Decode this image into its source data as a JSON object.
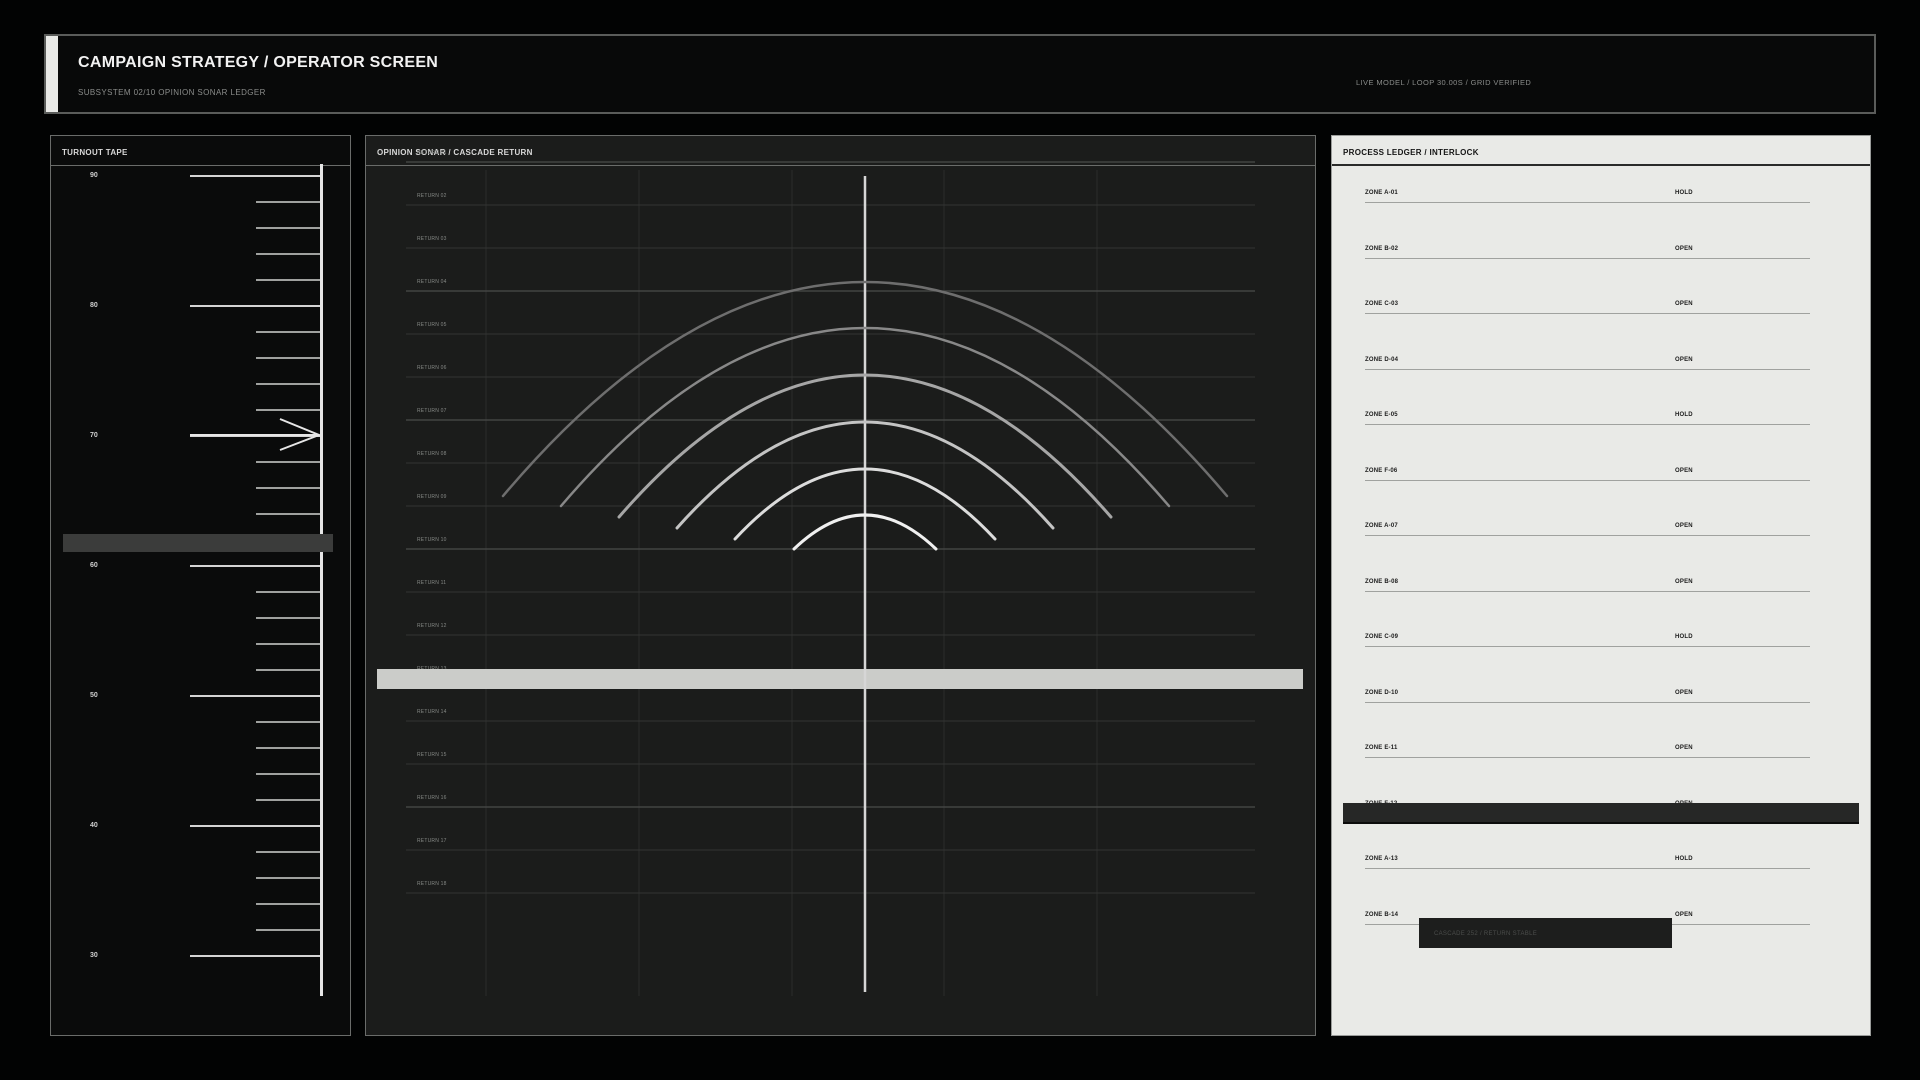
{
  "header": {
    "title": "CAMPAIGN STRATEGY / OPERATOR SCREEN",
    "subtitle": "SUBSYSTEM 02/10  OPINION SONAR LEDGER",
    "status": "LIVE MODEL / LOOP 30.00S / GRID VERIFIED"
  },
  "turnout_tape": {
    "title": "TURNOUT TAPE",
    "labels": [
      "90",
      "80",
      "70",
      "60",
      "50",
      "40",
      "30"
    ],
    "marker_value": 70
  },
  "sonar": {
    "title": "OPINION SONAR / CASCADE RETURN",
    "rows": [
      "RETURN 01",
      "RETURN 02",
      "RETURN 03",
      "RETURN 04",
      "RETURN 05",
      "RETURN 06",
      "RETURN 07",
      "RETURN 08",
      "RETURN 09",
      "RETURN 10",
      "RETURN 11",
      "RETURN 12",
      "RETURN 13",
      "RETURN 14",
      "RETURN 15",
      "RETURN 16",
      "RETURN 17",
      "RETURN 18"
    ]
  },
  "ledger": {
    "title": "PROCESS LEDGER / INTERLOCK",
    "rows": [
      {
        "zone": "ZONE A-01",
        "state": "HOLD"
      },
      {
        "zone": "ZONE B-02",
        "state": "OPEN"
      },
      {
        "zone": "ZONE C-03",
        "state": "OPEN"
      },
      {
        "zone": "ZONE D-04",
        "state": "OPEN"
      },
      {
        "zone": "ZONE E-05",
        "state": "HOLD"
      },
      {
        "zone": "ZONE F-06",
        "state": "OPEN"
      },
      {
        "zone": "ZONE A-07",
        "state": "OPEN"
      },
      {
        "zone": "ZONE B-08",
        "state": "OPEN"
      },
      {
        "zone": "ZONE C-09",
        "state": "HOLD"
      },
      {
        "zone": "ZONE D-10",
        "state": "OPEN"
      },
      {
        "zone": "ZONE E-11",
        "state": "OPEN"
      },
      {
        "zone": "ZONE F-12",
        "state": "OPEN"
      },
      {
        "zone": "ZONE A-13",
        "state": "HOLD"
      },
      {
        "zone": "ZONE B-14",
        "state": "OPEN"
      }
    ],
    "stamp": "CASCADE 252 / RETURN STABLE"
  }
}
